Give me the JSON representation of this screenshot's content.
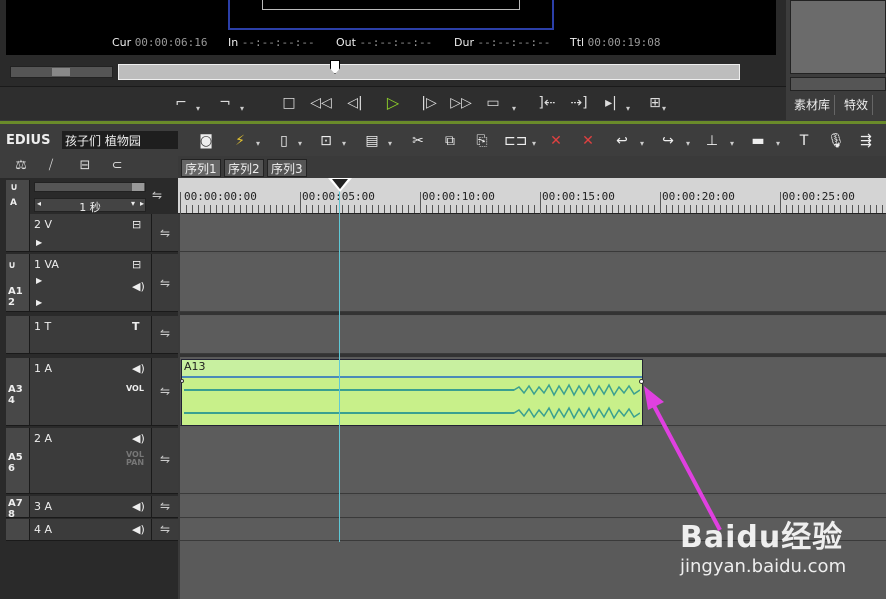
{
  "player": {
    "timecodes": [
      {
        "label": "Cur",
        "value": "00:00:06:16"
      },
      {
        "label": "In",
        "value": "--:--:--:--"
      },
      {
        "label": "Out",
        "value": "--:--:--:--"
      },
      {
        "label": "Dur",
        "value": "--:--:--:--"
      },
      {
        "label": "Ttl",
        "value": "00:00:19:08"
      }
    ]
  },
  "right_panel": {
    "tabs": [
      "素材库",
      "特效"
    ]
  },
  "toolbar": {
    "app_name": "EDIUS",
    "project_name": "孩子们 植物园"
  },
  "timeline": {
    "zoom_label": "1 秒",
    "sequence_tabs": [
      "序列1",
      "序列2",
      "序列3"
    ],
    "ruler_labels": [
      "00:00:00:00",
      "00:00:05:00",
      "00:00:10:00",
      "00:00:15:00",
      "00:00:20:00",
      "00:00:25:00"
    ],
    "tracks": [
      {
        "name": "2 V",
        "patch": ""
      },
      {
        "name": "1 VA",
        "patch": "A1 2"
      },
      {
        "name": "1 T",
        "patch": ""
      },
      {
        "name": "1 A",
        "patch": "A3 4",
        "vol": "VOL"
      },
      {
        "name": "2 A",
        "patch": "A5 6",
        "vol": "VOL",
        "pan": "PAN"
      },
      {
        "name": "3 A",
        "patch": "A7 8"
      },
      {
        "name": "4 A",
        "patch": ""
      }
    ],
    "clip": {
      "name": "A13"
    }
  },
  "watermark": {
    "logo": "Baidu经验",
    "url": "jingyan.baidu.com"
  },
  "colors": {
    "accent_green": "#8fd12a",
    "clip_fill": "#c8f08a",
    "playhead": "#5fc8d6",
    "arrow": "#e040e0"
  }
}
